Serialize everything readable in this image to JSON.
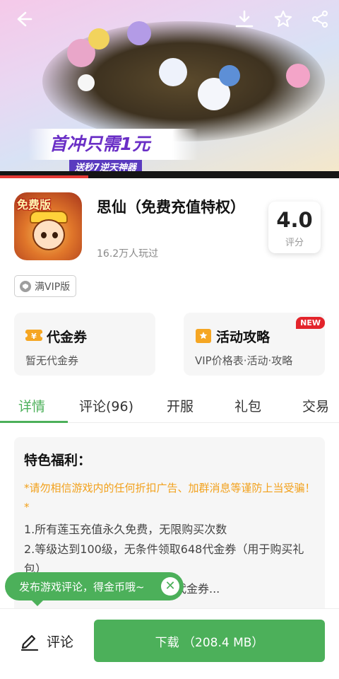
{
  "banner": {
    "promo_main": "首冲只需1元",
    "promo_sub": "送秒7逆天神器",
    "video_progress": 0.26
  },
  "nav": {
    "back_icon": "back-arrow-icon",
    "download_icon": "download-icon",
    "favorite_icon": "star-icon",
    "share_icon": "share-icon"
  },
  "app": {
    "icon_badge": "免费版",
    "title": "思仙（免费充值特权）",
    "plays": "16.2万人玩过",
    "rating": "4.0",
    "rating_label": "评分",
    "tag": "满VIP版"
  },
  "cards": [
    {
      "title": "代金券",
      "subtitle": "暂无代金券"
    },
    {
      "title": "活动攻略",
      "subtitle": "VIP价格表·活动·攻略",
      "badge": "NEW"
    }
  ],
  "tabs": [
    "详情",
    "评论(96)",
    "开服",
    "礼包",
    "交易"
  ],
  "detail": {
    "heading": "特色福利：",
    "warning": "*请勿相信游戏内的任何折扣广告、加群消息等谨防上当受骗！*",
    "lines": [
      "1.所有莲玉充值永久免费，无限购买次数",
      "2.等级达到100级，无条件领取648代金券（用于购买礼包）",
      "代金券..."
    ]
  },
  "toast": {
    "text": "发布游戏评论，得金币哦~",
    "close": "✕"
  },
  "bottom": {
    "comment_label": "评论",
    "download_label": "下载 （208.4 MB）"
  },
  "colors": {
    "accent": "#4cb05a",
    "warning": "#f2a11c",
    "badge": "#e3242b"
  }
}
